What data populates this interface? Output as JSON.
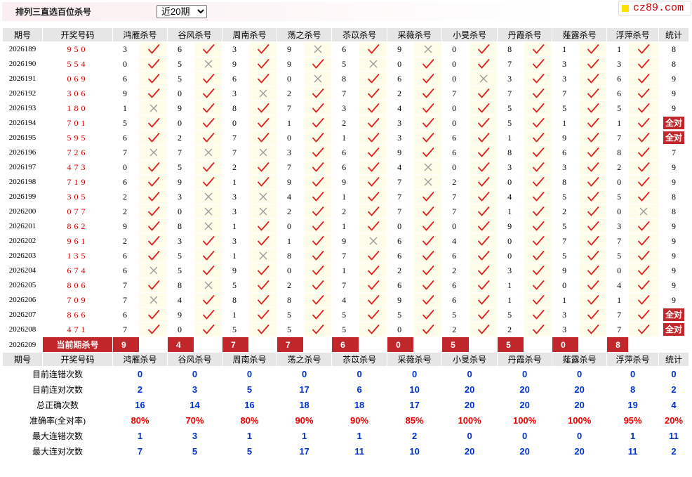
{
  "title": "排列三直选百位杀号",
  "period_select": {
    "value": "近20期",
    "options": [
      "近20期"
    ]
  },
  "site_badge": "cz89.com",
  "headers": [
    "期号",
    "开奖号码",
    "鸿雁杀号",
    "谷风杀号",
    "周南杀号",
    "荡之杀号",
    "苶苡杀号",
    "采薇杀号",
    "小旻杀号",
    "丹霞杀号",
    "薤露杀号",
    "浮萍杀号",
    "统计"
  ],
  "all_correct_label": "全对",
  "rows": [
    {
      "issue": "2026189",
      "draw": "950",
      "k": [
        3,
        6,
        3,
        9,
        6,
        9,
        0,
        8,
        1,
        1
      ],
      "ok": [
        1,
        1,
        1,
        0,
        1,
        0,
        1,
        1,
        1,
        1
      ],
      "stat": "8"
    },
    {
      "issue": "2026190",
      "draw": "554",
      "k": [
        0,
        5,
        9,
        9,
        5,
        0,
        0,
        7,
        3,
        3
      ],
      "ok": [
        1,
        0,
        1,
        1,
        0,
        1,
        1,
        1,
        1,
        1
      ],
      "stat": "8"
    },
    {
      "issue": "2026191",
      "draw": "069",
      "k": [
        6,
        5,
        6,
        0,
        8,
        6,
        0,
        3,
        3,
        6
      ],
      "ok": [
        1,
        1,
        1,
        0,
        1,
        1,
        0,
        1,
        1,
        1
      ],
      "stat": "9"
    },
    {
      "issue": "2026192",
      "draw": "306",
      "k": [
        9,
        0,
        3,
        2,
        7,
        2,
        7,
        7,
        7,
        6
      ],
      "ok": [
        1,
        1,
        0,
        1,
        1,
        1,
        1,
        1,
        1,
        1
      ],
      "stat": "9"
    },
    {
      "issue": "2026193",
      "draw": "180",
      "k": [
        1,
        9,
        8,
        7,
        3,
        4,
        0,
        5,
        5,
        5
      ],
      "ok": [
        0,
        1,
        1,
        1,
        1,
        1,
        1,
        1,
        1,
        1
      ],
      "stat": "9"
    },
    {
      "issue": "2026194",
      "draw": "701",
      "k": [
        5,
        0,
        0,
        1,
        2,
        3,
        0,
        5,
        1,
        1
      ],
      "ok": [
        1,
        1,
        1,
        1,
        1,
        1,
        1,
        1,
        1,
        1
      ],
      "stat": "全对"
    },
    {
      "issue": "2026195",
      "draw": "595",
      "k": [
        6,
        2,
        7,
        0,
        1,
        3,
        6,
        1,
        9,
        7
      ],
      "ok": [
        1,
        1,
        1,
        1,
        1,
        1,
        1,
        1,
        1,
        1
      ],
      "stat": "全对"
    },
    {
      "issue": "2026196",
      "draw": "726",
      "k": [
        7,
        7,
        7,
        3,
        6,
        9,
        6,
        8,
        6,
        8
      ],
      "ok": [
        0,
        0,
        0,
        1,
        1,
        1,
        1,
        1,
        1,
        1
      ],
      "stat": "7"
    },
    {
      "issue": "2026197",
      "draw": "473",
      "k": [
        0,
        5,
        2,
        7,
        6,
        4,
        0,
        3,
        3,
        2
      ],
      "ok": [
        1,
        1,
        1,
        1,
        1,
        0,
        1,
        1,
        1,
        1
      ],
      "stat": "9"
    },
    {
      "issue": "2026198",
      "draw": "719",
      "k": [
        6,
        9,
        1,
        9,
        9,
        7,
        2,
        0,
        8,
        0
      ],
      "ok": [
        1,
        1,
        1,
        1,
        1,
        0,
        1,
        1,
        1,
        1
      ],
      "stat": "9"
    },
    {
      "issue": "2026199",
      "draw": "305",
      "k": [
        2,
        3,
        3,
        4,
        1,
        7,
        7,
        4,
        5,
        5
      ],
      "ok": [
        1,
        0,
        0,
        1,
        1,
        1,
        1,
        1,
        1,
        1
      ],
      "stat": "8"
    },
    {
      "issue": "2026200",
      "draw": "077",
      "k": [
        2,
        0,
        3,
        2,
        2,
        7,
        7,
        1,
        2,
        0
      ],
      "ok": [
        1,
        0,
        0,
        1,
        1,
        1,
        1,
        1,
        1,
        0
      ],
      "stat": "8"
    },
    {
      "issue": "2026201",
      "draw": "862",
      "k": [
        9,
        8,
        1,
        0,
        1,
        0,
        0,
        9,
        5,
        3
      ],
      "ok": [
        1,
        0,
        1,
        1,
        1,
        1,
        1,
        1,
        1,
        1
      ],
      "stat": "9"
    },
    {
      "issue": "2026202",
      "draw": "961",
      "k": [
        2,
        3,
        3,
        1,
        9,
        6,
        4,
        0,
        7,
        7
      ],
      "ok": [
        1,
        1,
        1,
        1,
        0,
        1,
        1,
        1,
        1,
        1
      ],
      "stat": "9"
    },
    {
      "issue": "2026203",
      "draw": "135",
      "k": [
        6,
        5,
        1,
        8,
        7,
        6,
        6,
        0,
        5,
        5
      ],
      "ok": [
        1,
        1,
        0,
        1,
        1,
        1,
        1,
        1,
        1,
        1
      ],
      "stat": "9"
    },
    {
      "issue": "2026204",
      "draw": "674",
      "k": [
        6,
        5,
        9,
        0,
        1,
        2,
        2,
        3,
        9,
        0
      ],
      "ok": [
        0,
        1,
        1,
        1,
        1,
        1,
        1,
        1,
        1,
        1
      ],
      "stat": "9"
    },
    {
      "issue": "2026205",
      "draw": "806",
      "k": [
        7,
        8,
        5,
        2,
        7,
        6,
        6,
        1,
        0,
        4
      ],
      "ok": [
        1,
        0,
        1,
        1,
        1,
        1,
        1,
        1,
        1,
        1
      ],
      "stat": "9"
    },
    {
      "issue": "2026206",
      "draw": "709",
      "k": [
        7,
        4,
        8,
        8,
        4,
        9,
        6,
        1,
        1,
        1
      ],
      "ok": [
        0,
        1,
        1,
        1,
        1,
        1,
        1,
        1,
        1,
        1
      ],
      "stat": "9"
    },
    {
      "issue": "2026207",
      "draw": "866",
      "k": [
        6,
        9,
        1,
        5,
        5,
        5,
        5,
        5,
        3,
        7
      ],
      "ok": [
        1,
        1,
        1,
        1,
        1,
        1,
        1,
        1,
        1,
        1
      ],
      "stat": "全对"
    },
    {
      "issue": "2026208",
      "draw": "471",
      "k": [
        7,
        0,
        5,
        5,
        5,
        0,
        2,
        2,
        3,
        7
      ],
      "ok": [
        1,
        1,
        1,
        1,
        1,
        1,
        1,
        1,
        1,
        1
      ],
      "stat": "全对"
    }
  ],
  "current": {
    "issue": "2026209",
    "label": "当前期杀号",
    "k": [
      9,
      4,
      7,
      7,
      6,
      0,
      5,
      5,
      0,
      8
    ]
  },
  "summary": [
    {
      "label": "目前连错次数",
      "v": [
        "0",
        "0",
        "0",
        "0",
        "0",
        "0",
        "0",
        "0",
        "0",
        "0",
        "0"
      ]
    },
    {
      "label": "目前连对次数",
      "v": [
        "2",
        "3",
        "5",
        "17",
        "6",
        "10",
        "20",
        "20",
        "20",
        "8",
        "2"
      ]
    },
    {
      "label": "总正确次数",
      "v": [
        "16",
        "14",
        "16",
        "18",
        "18",
        "17",
        "20",
        "20",
        "20",
        "19",
        "4"
      ]
    },
    {
      "label": "准确率(全对率)",
      "v": [
        "80%",
        "70%",
        "80%",
        "90%",
        "90%",
        "85%",
        "100%",
        "100%",
        "100%",
        "95%",
        "20%"
      ]
    },
    {
      "label": "最大连错次数",
      "v": [
        "1",
        "3",
        "1",
        "1",
        "1",
        "2",
        "0",
        "0",
        "0",
        "1",
        "11"
      ]
    },
    {
      "label": "最大连对次数",
      "v": [
        "7",
        "5",
        "5",
        "17",
        "11",
        "10",
        "20",
        "20",
        "20",
        "11",
        "2"
      ]
    }
  ],
  "colors": {
    "accent_red": "#c0262a",
    "check_red": "#e02020",
    "cross_gray": "#999999",
    "summary_blue": "#0033cc",
    "mark_cell_bg": "#fdfdea",
    "header_bg": "#e6e6e6"
  },
  "icons": {
    "correct": "check-icon",
    "wrong": "cross-icon"
  }
}
